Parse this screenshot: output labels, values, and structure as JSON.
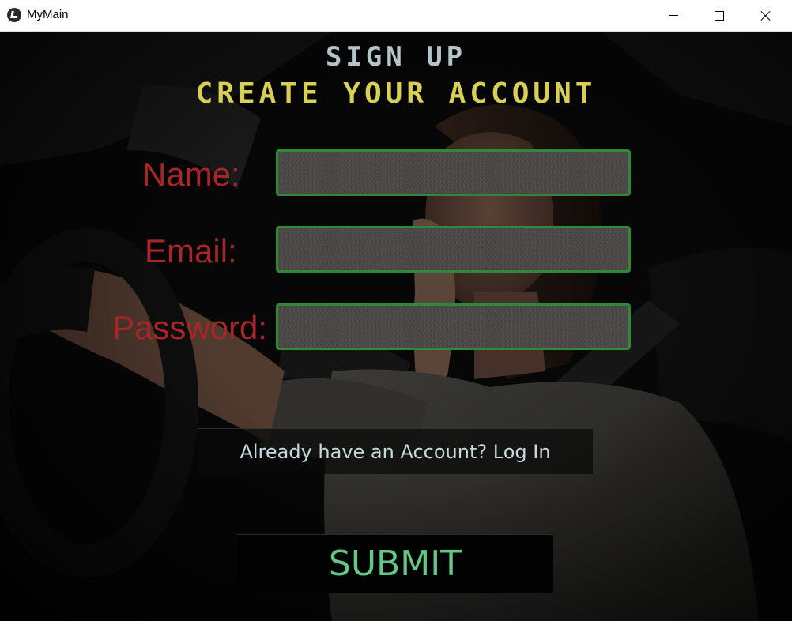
{
  "window": {
    "title": "MyMain",
    "app_icon": "kivy-logo-icon"
  },
  "header": {
    "title": "SIGN UP",
    "subtitle": "CREATE YOUR ACCOUNT"
  },
  "form": {
    "name_label": "Name:",
    "email_label": "Email:",
    "password_label": "Password:",
    "name_value": "",
    "email_value": "",
    "password_value": ""
  },
  "login_link": "Already have an Account? Log In",
  "submit_label": "SUBMIT",
  "colors": {
    "title": "#b6c4c8",
    "subtitle": "#d8cf55",
    "label": "#a8262a",
    "input_border": "#2e8a38",
    "submit_text": "#64c688",
    "link_text": "#c6dbe0"
  }
}
